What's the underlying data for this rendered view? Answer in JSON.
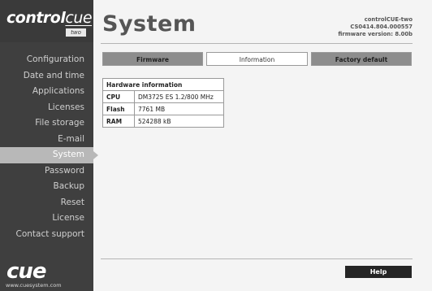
{
  "logo": {
    "word_bold": "control",
    "word_light": "cue",
    "sub": "two"
  },
  "sidebar": {
    "items": [
      {
        "label": "Configuration"
      },
      {
        "label": "Date and time"
      },
      {
        "label": "Applications"
      },
      {
        "label": "Licenses"
      },
      {
        "label": "File storage"
      },
      {
        "label": "E-mail"
      },
      {
        "label": "System"
      },
      {
        "label": "Password"
      },
      {
        "label": "Backup"
      },
      {
        "label": "Reset"
      },
      {
        "label": "License"
      },
      {
        "label": "Contact support"
      }
    ],
    "active": "System"
  },
  "brand": {
    "logo": "cue",
    "url": "www.cuesystem.com"
  },
  "header": {
    "title": "System",
    "device_name": "controlCUE-two",
    "serial": "CS0414.804.000557",
    "firmware": "firmware version: 8.00b"
  },
  "tabs": [
    {
      "label": "Firmware"
    },
    {
      "label": "Information"
    },
    {
      "label": "Factory default"
    }
  ],
  "hardware": {
    "heading": "Hardware information",
    "rows": [
      {
        "key": "CPU",
        "value": "DM3725 ES 1.2/800 MHz"
      },
      {
        "key": "Flash",
        "value": "7761 MB"
      },
      {
        "key": "RAM",
        "value": "524288 kB"
      }
    ]
  },
  "footer": {
    "help_label": "Help"
  },
  "colors": {
    "sidebar": "#3f3f3f",
    "active_item": "#b8b8b8",
    "tab_inactive": "#8d8d8d",
    "help_button": "#252525"
  }
}
